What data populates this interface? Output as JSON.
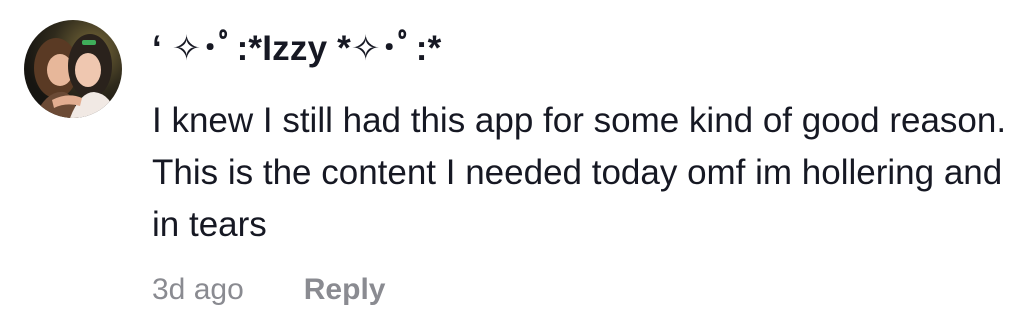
{
  "comment": {
    "username": "‘ ✧･ﾟ:*Izzy *✧･ﾟ:*",
    "text": "I knew I still had this app for some kind of good reason. This is the content I needed today omf im hollering and in tears",
    "timestamp": "3d ago",
    "reply_label": "Reply",
    "avatar_icon": "user-avatar-photo"
  },
  "colors": {
    "text_primary": "#161823",
    "text_secondary": "#8a8b91",
    "background": "#ffffff"
  }
}
